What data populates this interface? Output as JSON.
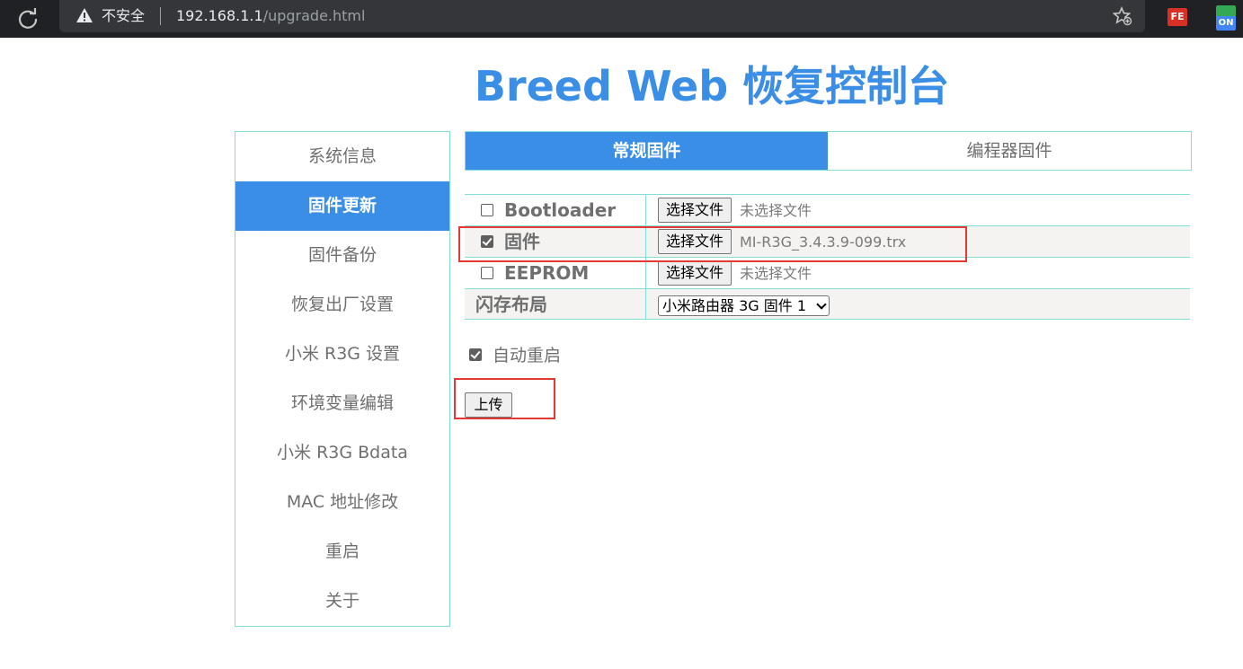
{
  "browser": {
    "insecure_label": "不安全",
    "url_host": "192.168.1.1",
    "url_path": "/upgrade.html",
    "ext_fe_label": "FE",
    "ext_on_label": "ON"
  },
  "page": {
    "title": "Breed Web 恢复控制台"
  },
  "sidebar": {
    "items": [
      {
        "label": "系统信息"
      },
      {
        "label": "固件更新"
      },
      {
        "label": "固件备份"
      },
      {
        "label": "恢复出厂设置"
      },
      {
        "label": "小米 R3G 设置"
      },
      {
        "label": "环境变量编辑"
      },
      {
        "label": "小米 R3G Bdata"
      },
      {
        "label": "MAC 地址修改"
      },
      {
        "label": "重启"
      },
      {
        "label": "关于"
      }
    ],
    "active_index": 1
  },
  "tabs": [
    {
      "label": "常规固件",
      "active": true
    },
    {
      "label": "编程器固件",
      "active": false
    }
  ],
  "form": {
    "rows": [
      {
        "label": "Bootloader",
        "checked": false,
        "button": "选择文件",
        "file": "未选择文件"
      },
      {
        "label": "固件",
        "checked": true,
        "button": "选择文件",
        "file": "MI-R3G_3.4.3.9-099.trx"
      },
      {
        "label": "EEPROM",
        "checked": false,
        "button": "选择文件",
        "file": "未选择文件"
      }
    ],
    "flash_layout": {
      "label": "闪存布局",
      "selected": "小米路由器 3G 固件 1"
    },
    "auto_reboot": {
      "label": "自动重启",
      "checked": true
    },
    "upload_label": "上传"
  },
  "colors": {
    "accent": "#3a8ee6",
    "border": "#80e0d8",
    "highlight": "#e53935"
  }
}
